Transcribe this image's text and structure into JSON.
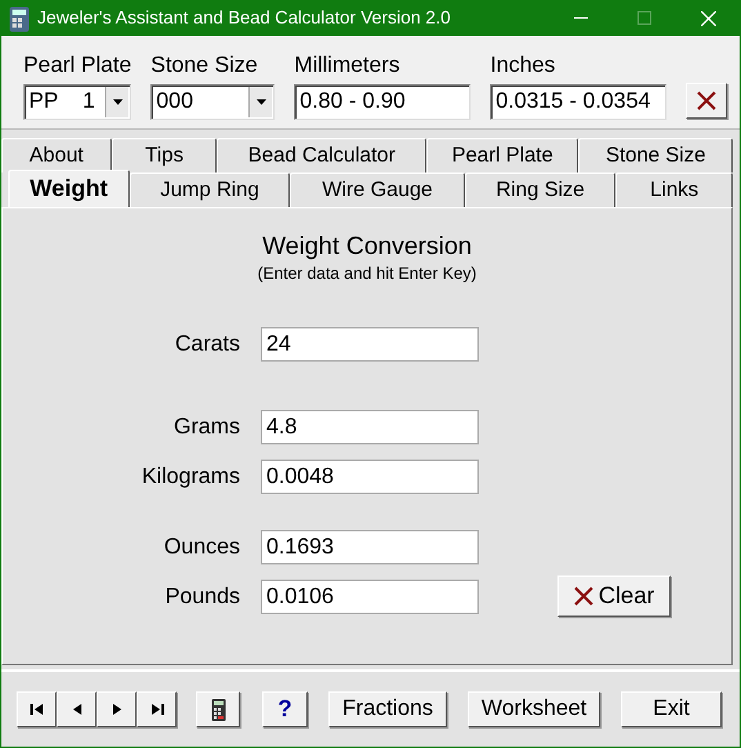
{
  "window": {
    "title": "Jeweler's Assistant and Bead Calculator Version 2.0"
  },
  "header_fields": [
    {
      "label": "Pearl Plate",
      "kind": "select",
      "value": "PP    1"
    },
    {
      "label": "Stone Size",
      "kind": "select",
      "value": "000"
    },
    {
      "label": "Millimeters",
      "kind": "text",
      "value": "0.80 - 0.90"
    },
    {
      "label": "Inches",
      "kind": "text",
      "value": "0.0315 - 0.0354"
    }
  ],
  "tab_rows": [
    [
      {
        "label": "About",
        "selected": false
      },
      {
        "label": "Tips",
        "selected": false
      },
      {
        "label": "Bead Calculator",
        "selected": false
      },
      {
        "label": "Pearl Plate",
        "selected": false
      },
      {
        "label": "Stone Size",
        "selected": false
      }
    ],
    [
      {
        "label": "Weight",
        "selected": true
      },
      {
        "label": "Jump Ring",
        "selected": false
      },
      {
        "label": "Wire Gauge",
        "selected": false
      },
      {
        "label": "Ring Size",
        "selected": false
      },
      {
        "label": "Links",
        "selected": false
      }
    ]
  ],
  "panel": {
    "title": "Weight Conversion",
    "subtitle": "(Enter data and hit Enter Key)",
    "groups": [
      [
        {
          "label": "Carats",
          "value": "24"
        }
      ],
      [
        {
          "label": "Grams",
          "value": "4.8"
        },
        {
          "label": "Kilograms",
          "value": "0.0048"
        }
      ],
      [
        {
          "label": "Ounces",
          "value": "0.1693"
        },
        {
          "label": "Pounds",
          "value": "0.0106"
        }
      ]
    ],
    "clear_button": "Clear"
  },
  "toolbar": [
    {
      "kind": "first"
    },
    {
      "kind": "prev"
    },
    {
      "kind": "next"
    },
    {
      "kind": "last"
    },
    {
      "kind": "calculator"
    },
    {
      "kind": "help",
      "label": "?"
    },
    {
      "kind": "text",
      "label": "Fractions"
    },
    {
      "kind": "text",
      "label": "Worksheet"
    },
    {
      "kind": "text",
      "label": "Exit"
    }
  ]
}
